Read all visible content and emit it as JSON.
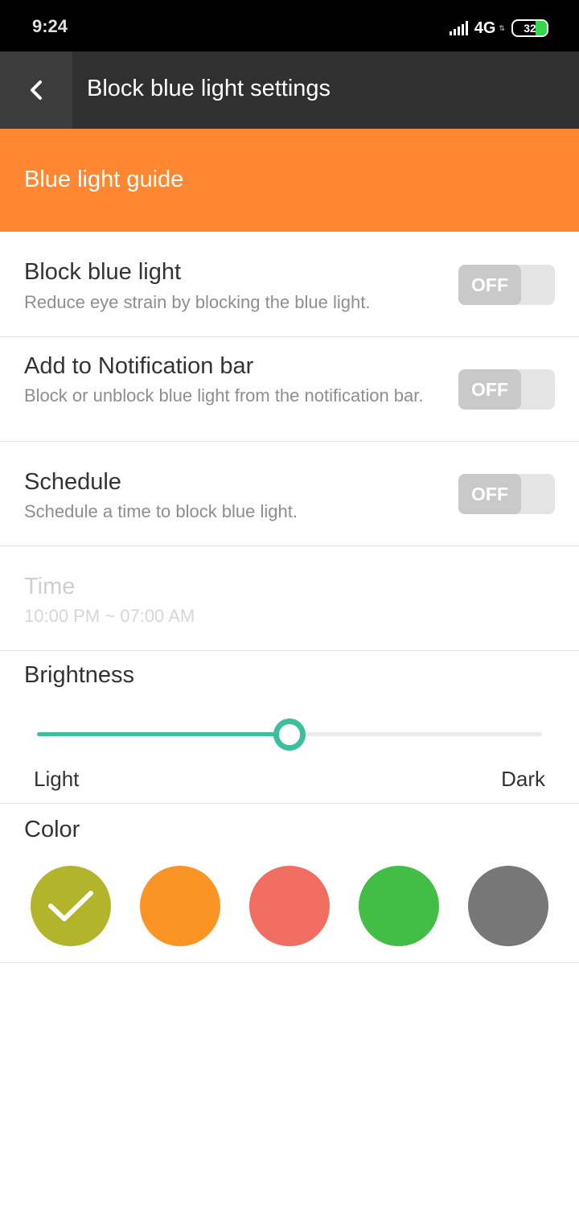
{
  "status_bar": {
    "time": "9:24",
    "network": "4G",
    "battery": "32",
    "battery_color": "#32d74b"
  },
  "app_bar": {
    "title": "Block blue light settings",
    "back_icon": "chevron-left-icon"
  },
  "guide": {
    "label": "Blue light guide",
    "color": "#ff8731"
  },
  "settings": [
    {
      "title": "Block blue light",
      "subtitle": "Reduce eye strain by blocking the blue light.",
      "toggle": "OFF"
    },
    {
      "title": "Add to Notification bar",
      "subtitle": "Block or unblock blue light from the notification bar.",
      "toggle": "OFF"
    },
    {
      "title": "Schedule",
      "subtitle": "Schedule a time to block blue light.",
      "toggle": "OFF"
    }
  ],
  "time_setting": {
    "title": "Time",
    "value": "10:00 PM ~ 07:00 AM",
    "enabled": false
  },
  "brightness": {
    "title": "Brightness",
    "min_label": "Light",
    "max_label": "Dark",
    "level": 0.5,
    "accent": "#3dbf9f"
  },
  "color": {
    "title": "Color",
    "options": [
      {
        "name": "olive",
        "hex": "#b2b42c",
        "selected": true
      },
      {
        "name": "orange",
        "hex": "#fa9425",
        "selected": false
      },
      {
        "name": "coral",
        "hex": "#f16d61",
        "selected": false
      },
      {
        "name": "green",
        "hex": "#42bd45",
        "selected": false
      },
      {
        "name": "gray",
        "hex": "#777777",
        "selected": false
      }
    ]
  }
}
